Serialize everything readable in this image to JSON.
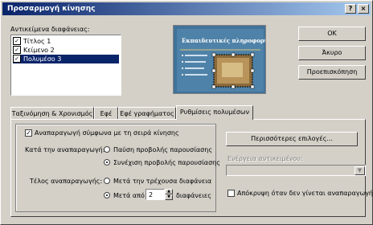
{
  "window": {
    "title": "Προσαρμογή κίνησης",
    "help_label": "?",
    "close_label": "×"
  },
  "objects": {
    "label": "Αντικείμενα διαφάνειας:",
    "items": [
      {
        "label": "Τίτλος 1",
        "checked": true,
        "selected": false
      },
      {
        "label": "Κείμενο 2",
        "checked": true,
        "selected": false
      },
      {
        "label": "Πολυμέσο 3",
        "checked": true,
        "selected": true
      }
    ]
  },
  "preview": {
    "title": "Εκπαιδευτικές πληροφορίες"
  },
  "buttons": {
    "ok": "OK",
    "cancel": "Άκυρο",
    "preview": "Προεπισκόπηση"
  },
  "tabs": [
    {
      "label": "Ταξινόμηση & Χρονισμός",
      "active": false
    },
    {
      "label": "Εφέ",
      "active": false
    },
    {
      "label": "Εφέ γραφήματος",
      "active": false
    },
    {
      "label": "Ρυθμίσεις πολυμέσων",
      "active": true
    }
  ],
  "settings": {
    "play_in_order": {
      "label": "Αναπαραγωγή σύμφωνα με τη σειρά κίνησης",
      "checked": true
    },
    "while_playing": {
      "label": "Κατά την αναπαραγωγή:",
      "options": [
        {
          "label": "Παύση προβολής παρουσίασης",
          "selected": false
        },
        {
          "label": "Συνέχιση προβολής παρουσίασης",
          "selected": true
        }
      ]
    },
    "stop_playing": {
      "label": "Τέλος αναπαραγωγής:",
      "options": [
        {
          "label": "Μετά την τρέχουσα διαφάνεια",
          "selected": false
        },
        {
          "label": "Μετά από",
          "selected": true
        }
      ],
      "slides_value": "2",
      "slides_label": "διαφάνειες"
    },
    "more_options": "Περισσότερες επιλογές...",
    "object_action_label": "Ενέργεια αντικειμένου:",
    "hide_when_not_playing": {
      "label": "Απόκρυψη όταν δεν γίνεται αναπαραγωγή",
      "checked": false
    }
  }
}
